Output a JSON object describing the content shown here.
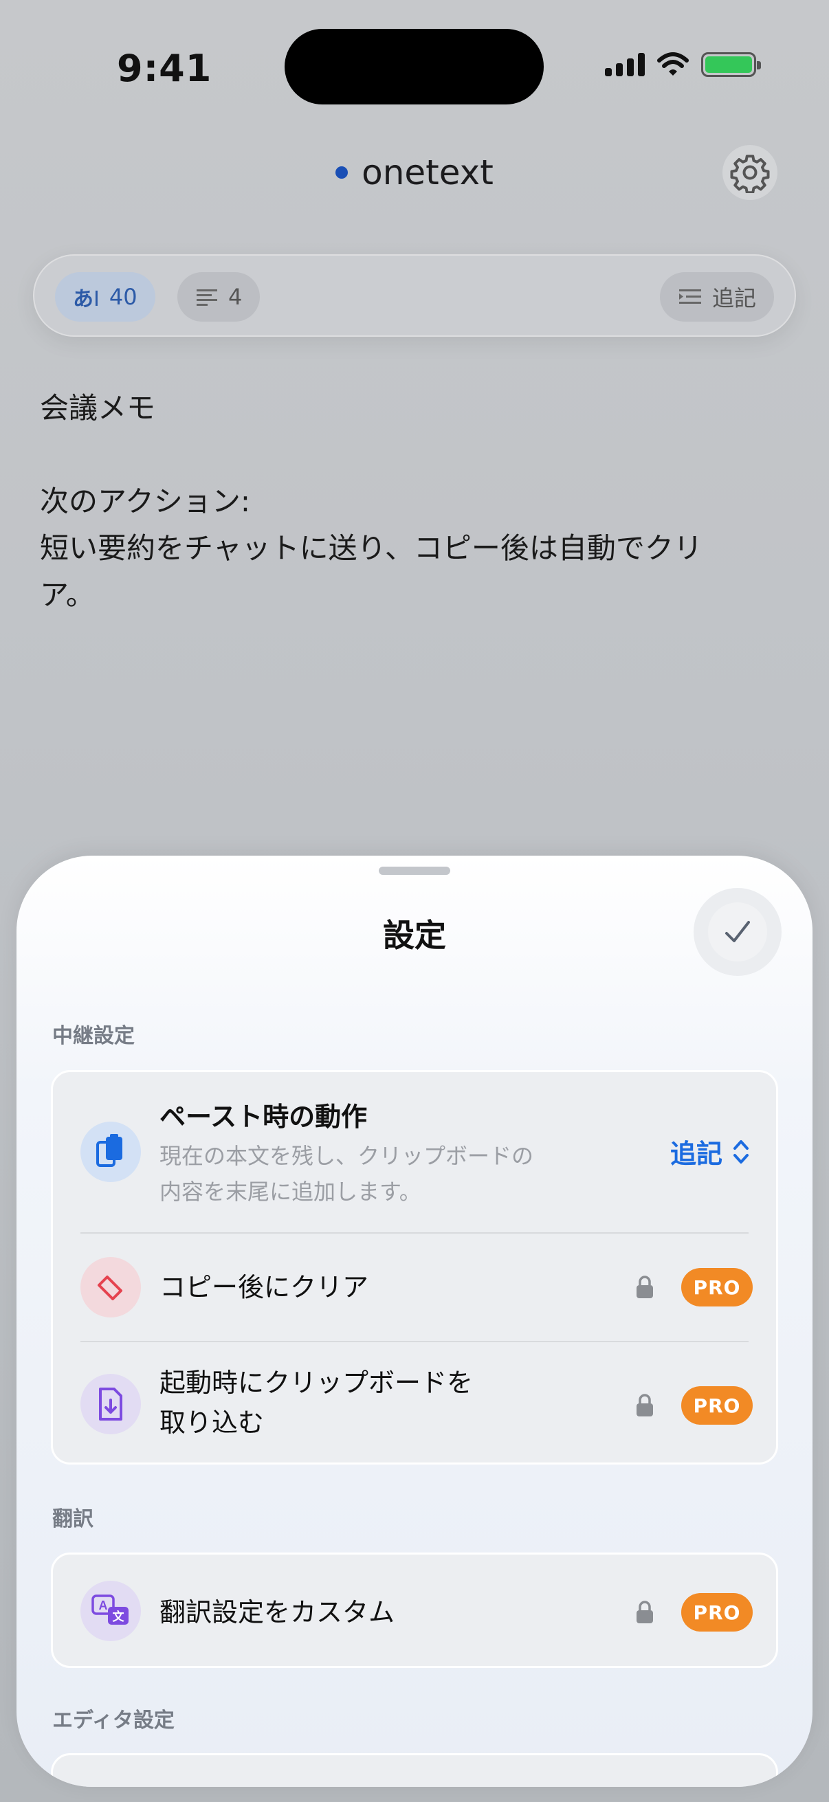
{
  "status_bar": {
    "time": "9:41"
  },
  "header": {
    "title": "onetext"
  },
  "toolbar": {
    "chars_icon": "あ",
    "char_count": "40",
    "line_count": "4",
    "mode_label": "追記"
  },
  "note": {
    "lines": [
      "会議メモ",
      "",
      "次のアクション:",
      "短い要約をチャットに送り、コピー後は自動でクリ",
      "ア。"
    ]
  },
  "sheet": {
    "title": "設定",
    "sections": [
      {
        "label": "中継設定",
        "rows": [
          {
            "title": "ペースト時の動作",
            "subtitle_lines": [
              "現在の本文を残し、クリップボードの",
              "内容を末尾に追加します。"
            ],
            "value": "追記"
          },
          {
            "title": "コピー後にクリア",
            "badge": "PRO"
          },
          {
            "title_lines": [
              "起動時にクリップボードを",
              "取り込む"
            ],
            "badge": "PRO"
          }
        ]
      },
      {
        "label": "翻訳",
        "rows": [
          {
            "title": "翻訳設定をカスタム",
            "badge": "PRO"
          }
        ]
      },
      {
        "label": "エディタ設定"
      }
    ]
  },
  "colors": {
    "accent": "#1b6be0",
    "pro_badge": "#f28a25",
    "status_dot": "#1a4fb5"
  },
  "icons": {
    "paste_behavior": "clipboard-icon",
    "clear_after_copy": "eraser-icon",
    "import_on_launch": "file-download-icon",
    "translate": "translate-icon",
    "done": "checkmark-icon",
    "settings": "gear-icon"
  }
}
